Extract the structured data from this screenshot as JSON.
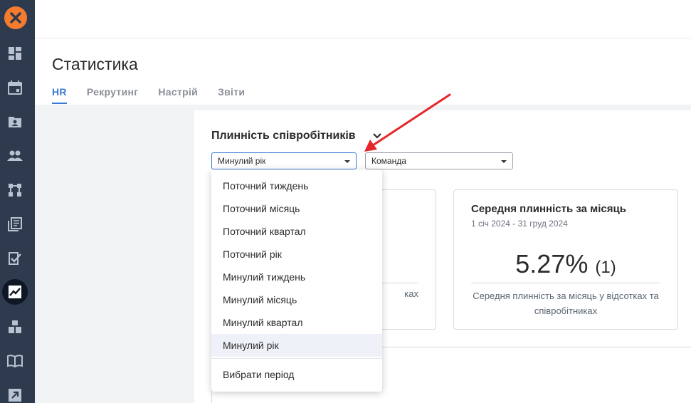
{
  "sidebar": {
    "items": [
      {
        "icon": "dashboard-icon"
      },
      {
        "icon": "calendar-icon"
      },
      {
        "icon": "contact-folder-icon"
      },
      {
        "icon": "people-icon"
      },
      {
        "icon": "org-structure-icon"
      },
      {
        "icon": "documents-icon"
      },
      {
        "icon": "tasks-checklist-icon"
      },
      {
        "icon": "statistics-chart-icon",
        "active": true
      },
      {
        "icon": "inventory-boxes-icon"
      },
      {
        "icon": "knowledge-book-icon"
      },
      {
        "icon": "external-link-icon"
      }
    ]
  },
  "header": {
    "title": "Статистика",
    "tabs": [
      {
        "label": "HR",
        "active": true
      },
      {
        "label": "Рекрутинг"
      },
      {
        "label": "Настрій"
      },
      {
        "label": "Звіти"
      }
    ]
  },
  "card": {
    "title": "Плинність співробітників",
    "period_select": {
      "value": "Минулий рік"
    },
    "team_select": {
      "value": "Команда"
    }
  },
  "period_dropdown": {
    "options": [
      "Поточний тиждень",
      "Поточний місяць",
      "Поточний квартал",
      "Поточний рік",
      "Минулий тиждень",
      "Минулий місяць",
      "Минулий квартал",
      "Минулий рік"
    ],
    "selected": "Минулий рік",
    "custom_option": "Вибрати період"
  },
  "stats": {
    "left_card_desc_fragment": "ках",
    "monthly_card": {
      "title": "Середня плинність за місяць",
      "date_range": "1 січ 2024 - 31 груд 2024",
      "value": "5.27%",
      "count": "(1)",
      "description": "Середня плинність за місяць у відсотках та співробітниках"
    }
  },
  "colors": {
    "sidebar_bg": "#2e3a4d",
    "accent": "#3a7bd5",
    "logo": "#f57c2e",
    "annotation_arrow": "#e5262a"
  }
}
